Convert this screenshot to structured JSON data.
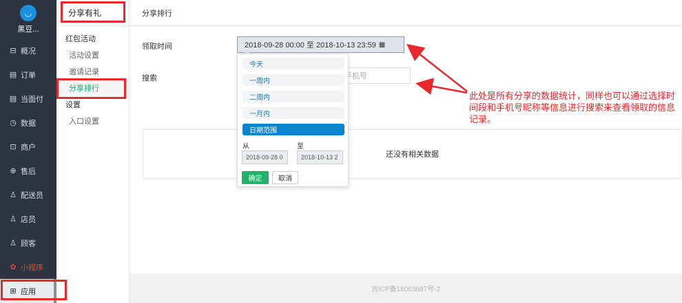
{
  "sidebar": {
    "brand_name": "黑豆...",
    "items": [
      {
        "label": "概况",
        "icon": "overview-icon",
        "glyph": "⊟"
      },
      {
        "label": "订单",
        "icon": "order-icon",
        "glyph": "▤"
      },
      {
        "label": "当面付",
        "icon": "pay-icon",
        "glyph": "▤"
      },
      {
        "label": "数据",
        "icon": "chart-icon",
        "glyph": "◷"
      },
      {
        "label": "商户",
        "icon": "store-icon",
        "glyph": "⊡"
      },
      {
        "label": "售后",
        "icon": "aftersale-icon",
        "glyph": "⊕"
      },
      {
        "label": "配送员",
        "icon": "courier-icon",
        "glyph": "♙"
      },
      {
        "label": "店员",
        "icon": "clerk-icon",
        "glyph": "♙"
      },
      {
        "label": "顾客",
        "icon": "customer-icon",
        "glyph": "♙"
      },
      {
        "label": "小程序",
        "icon": "miniapp-icon",
        "glyph": "✿"
      },
      {
        "label": "应用",
        "icon": "apps-icon",
        "glyph": "⊞"
      }
    ]
  },
  "subnav": {
    "title": "分享有礼",
    "group1": "红包活动",
    "item_activity": "活动设置",
    "item_invite": "邀请记录",
    "item_share": "分享排行",
    "group2": "设置",
    "item_entry": "入口设置"
  },
  "topbar": {
    "title": "分享排行"
  },
  "filters": {
    "time_label": "领取时间",
    "date_range": "2018-09-28 00:00 至 2018-10-13 23:59",
    "search_label": "搜索",
    "search_placeholder": "手机号"
  },
  "picker": {
    "ranges": [
      "今天",
      "一周内",
      "二周内",
      "一月内",
      "日期范围"
    ],
    "from_label": "从",
    "to_label": "至",
    "from_value": "2018-09-28 0",
    "to_value": "2018-10-13 2",
    "ok_label": "确定",
    "cancel_label": "取消"
  },
  "table": {
    "empty_text": "还没有相关数据"
  },
  "annotation": "此处是所有分享的数据统计，同样也可以通过选择时间段和手机号昵称等信息进行搜索来查看领取的信息记录。",
  "footer": "吉ICP备18003687号-2",
  "colors": {
    "sidebar_bg": "#2b3440",
    "highlight_red": "#e8282b",
    "active_green": "#1ea47a",
    "picker_active_blue": "#0b84cc",
    "ok_green": "#23b26b"
  }
}
